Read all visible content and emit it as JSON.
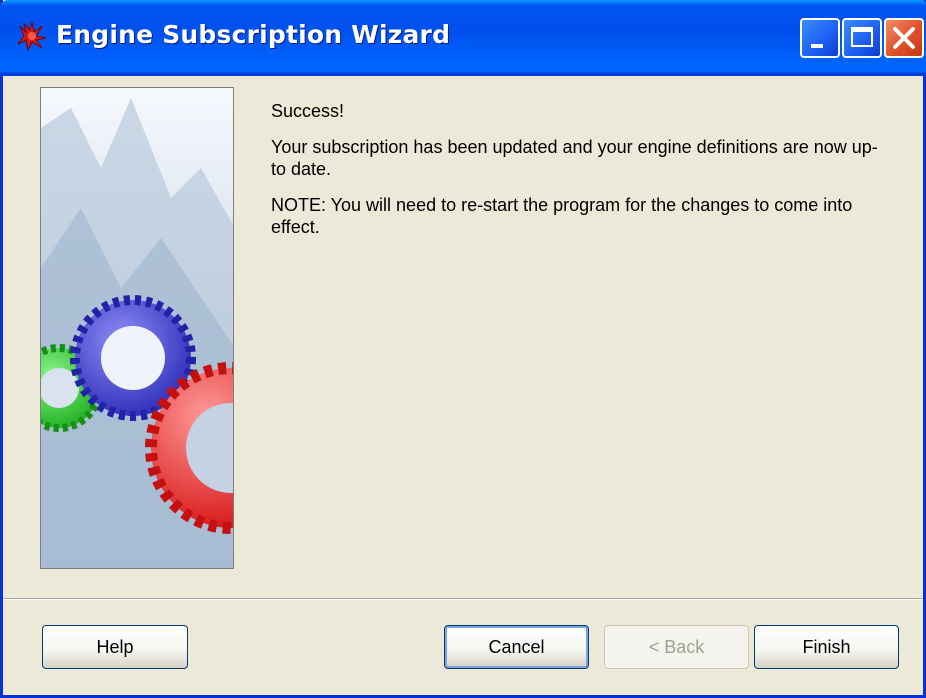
{
  "window": {
    "title": "Engine Subscription Wizard",
    "app_icon": "red-scorpion-icon",
    "controls": [
      "minimize-icon",
      "maximize-icon",
      "close-icon"
    ]
  },
  "side_image": {
    "icon": "gears-illustration"
  },
  "content": {
    "heading": "Success!",
    "message": "Your subscription has been updated and your engine definitions are now up-to date.",
    "note": "NOTE: You will need to re-start the program for the changes to come into effect."
  },
  "buttons": {
    "help": "Help",
    "cancel": "Cancel",
    "back": "< Back",
    "back_enabled": false,
    "finish": "Finish"
  },
  "colors": {
    "titlebar": "#0054e3",
    "dialog_bg": "#ece9d8",
    "gear_blue": "#3a3ad6",
    "gear_red": "#ee2a2a",
    "gear_green": "#2fcf2f"
  }
}
